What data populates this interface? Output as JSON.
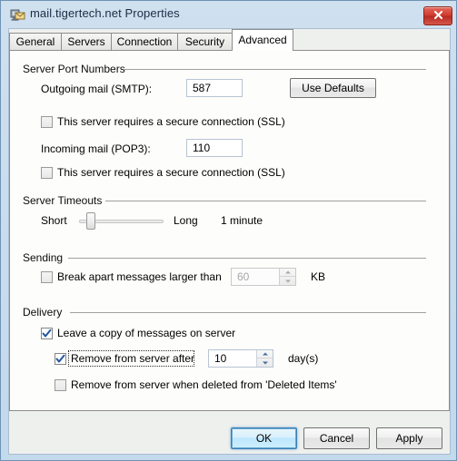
{
  "window": {
    "title": "mail.tigertech.net Properties",
    "icon": "mail-account-icon",
    "close_label": "Close"
  },
  "tabs": [
    {
      "label": "General",
      "active": false
    },
    {
      "label": "Servers",
      "active": false
    },
    {
      "label": "Connection",
      "active": false
    },
    {
      "label": "Security",
      "active": false
    },
    {
      "label": "Advanced",
      "active": true
    }
  ],
  "groups": {
    "ports": {
      "legend": "Server Port Numbers",
      "outgoing_label": "Outgoing mail (SMTP):",
      "outgoing_value": "587",
      "outgoing_ssl_label": "This server requires a secure connection (SSL)",
      "outgoing_ssl_checked": false,
      "incoming_label": "Incoming mail (POP3):",
      "incoming_value": "110",
      "incoming_ssl_label": "This server requires a secure connection (SSL)",
      "incoming_ssl_checked": false,
      "use_defaults_label": "Use Defaults"
    },
    "timeouts": {
      "legend": "Server Timeouts",
      "short_label": "Short",
      "long_label": "Long",
      "value_label": "1 minute"
    },
    "sending": {
      "legend": "Sending",
      "break_apart_label": "Break apart messages larger than",
      "break_apart_checked": false,
      "size_value": "60",
      "unit_label": "KB"
    },
    "delivery": {
      "legend": "Delivery",
      "leave_copy_label": "Leave a copy of messages on server",
      "leave_copy_checked": true,
      "remove_after_label": "Remove from server after",
      "remove_after_checked": true,
      "days_value": "10",
      "days_unit_label": "day(s)",
      "remove_deleted_label": "Remove from server when deleted from 'Deleted Items'",
      "remove_deleted_checked": false
    }
  },
  "footer": {
    "ok_label": "OK",
    "cancel_label": "Cancel",
    "apply_label": "Apply"
  },
  "colors": {
    "accent": "#3c7fb1",
    "close": "#cf3a2c",
    "check": "#21569e"
  }
}
